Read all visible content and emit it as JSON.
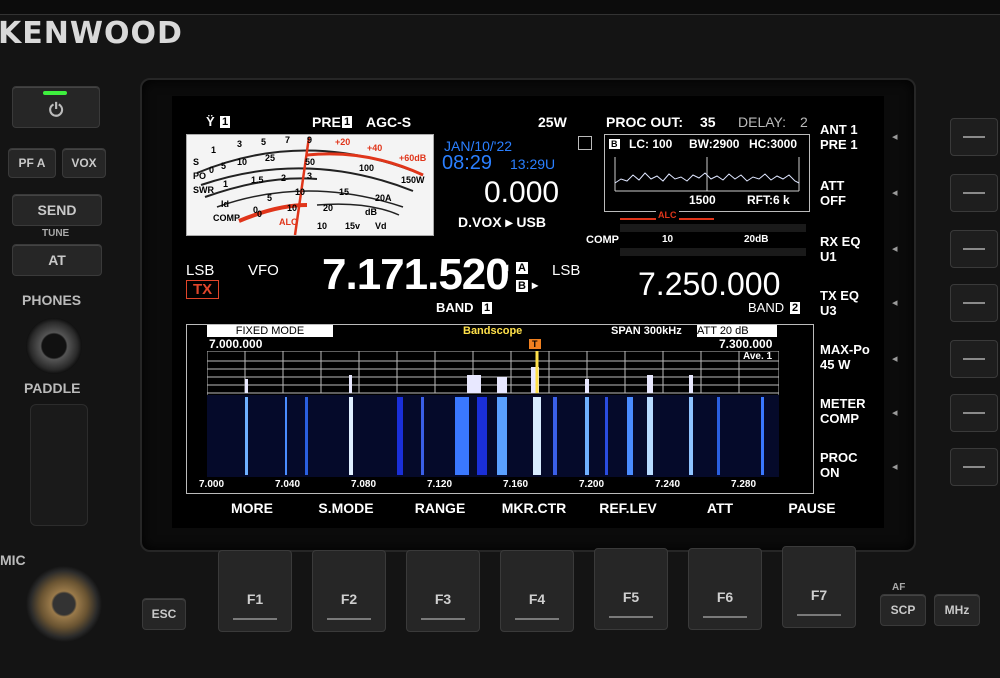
{
  "radio": {
    "brand": "KENWOOD",
    "left_buttons": {
      "pfa": "PF A",
      "vox": "VOX",
      "send": "SEND",
      "tune": "TUNE",
      "at": "AT",
      "phones": "PHONES",
      "paddle": "PADDLE",
      "mic": "MIC"
    },
    "bottom_buttons": {
      "esc": "ESC",
      "f_keys": [
        "F1",
        "F2",
        "F3",
        "F4",
        "F5",
        "F6",
        "F7"
      ],
      "af": "AF",
      "scp": "SCP",
      "mhz": "MHz"
    }
  },
  "screen": {
    "status_bar": {
      "ant": "1",
      "pre_label": "PRE",
      "pre_value": "1",
      "agc": "AGC-S",
      "power": "25W",
      "proc_out_label": "PROC OUT:",
      "proc_out_value": "35",
      "delay_label": "DELAY:",
      "delay_value": "2"
    },
    "meter": {
      "s_scale": [
        "S",
        "1",
        "3",
        "5",
        "7",
        "9",
        "+20",
        "+40",
        "+60dB"
      ],
      "po_scale": [
        "PO",
        "0",
        "5",
        "10",
        "25",
        "50",
        "100",
        "150W"
      ],
      "swr_scale": [
        "SWR",
        "1",
        "1.5",
        "2",
        "3"
      ],
      "id_scale": [
        "Id",
        "0",
        "5",
        "10",
        "15",
        "20A"
      ],
      "comp_scale": [
        "COMP",
        "0",
        "10",
        "20",
        "dB"
      ],
      "alc_label": "ALC",
      "vd_scale": [
        "10",
        "15v",
        "Vd"
      ]
    },
    "clock": {
      "date": "JAN/10/'22",
      "time_local": "08:29",
      "time_utc": "13:29U",
      "rit": "0.000",
      "mode_path": "D.VOX",
      "mode": "USB"
    },
    "scope_mini": {
      "b_tag": "B",
      "lc": "LC: 100",
      "bw": "BW:2900",
      "hc": "HC:3000",
      "center": "1500",
      "rft": "RFT:6 k"
    },
    "alc_comp": {
      "alc": "ALC",
      "comp": "COMP",
      "comp_10": "10",
      "comp_20": "20dB"
    },
    "vfo_a": {
      "mode": "LSB",
      "vfo_label": "VFO",
      "tx": "TX",
      "freq": "7.171.520",
      "band_label": "BAND",
      "band_num": "1",
      "a_tag": "A",
      "b_tag": "B"
    },
    "vfo_b": {
      "mode": "LSB",
      "freq": "7.250.000",
      "band_label": "BAND",
      "band_num": "2"
    },
    "bandscope": {
      "fixed_mode": "FIXED MODE",
      "title": "Bandscope",
      "span": "SPAN  300kHz",
      "att": "ATT  20 dB",
      "start": "7.000.000",
      "end": "7.300.000",
      "ave": "Ave. 1",
      "marker": "T",
      "ticks": [
        "7.000",
        "7.040",
        "7.080",
        "7.120",
        "7.160",
        "7.200",
        "7.240",
        "7.280"
      ]
    },
    "right_menu": [
      {
        "l1": "ANT 1",
        "l2": "PRE 1"
      },
      {
        "l1": "ATT",
        "l2": "OFF"
      },
      {
        "l1": "RX EQ",
        "l2": "U1"
      },
      {
        "l1": "TX EQ",
        "l2": "U3"
      },
      {
        "l1": "MAX-Po",
        "l2": "45 W"
      },
      {
        "l1": "METER",
        "l2": "COMP"
      },
      {
        "l1": "PROC",
        "l2": "ON"
      }
    ],
    "softkeys": [
      "MORE",
      "S.MODE",
      "RANGE",
      "MKR.CTR",
      "REF.LEV",
      "ATT",
      "PAUSE"
    ]
  },
  "colors": {
    "accent_blue": "#2a7fff",
    "tx_red": "#e0452a",
    "meter_red": "#e0351a",
    "waterfall_blue": "#1a2fd8"
  }
}
